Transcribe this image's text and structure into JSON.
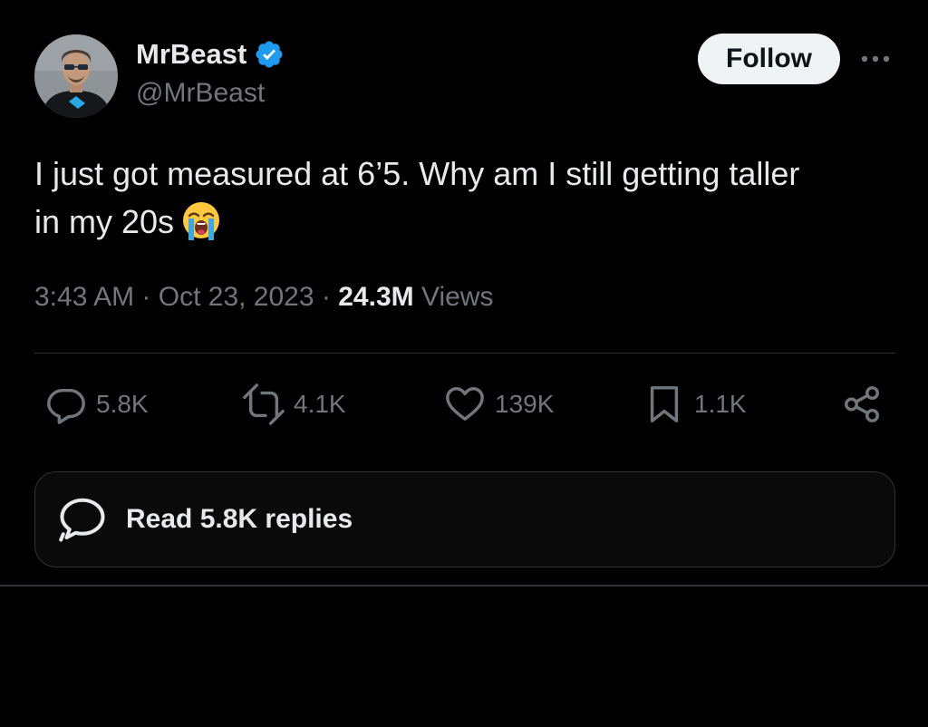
{
  "author": {
    "display_name": "MrBeast",
    "handle": "@MrBeast",
    "verified": true,
    "verified_color": "#1d9bf0",
    "avatar_icon": "profile-photo"
  },
  "header": {
    "follow_label": "Follow",
    "more_icon": "more-horizontal-icon"
  },
  "tweet": {
    "text_line1": "I just got measured at 6’5. Why am I still getting taller",
    "text_line2": "in my 20s",
    "emoji": "loudly-crying-face",
    "time": "3:43 AM",
    "date": "Oct 23, 2023",
    "separator": "·",
    "views_count": "24.3M",
    "views_label": "Views"
  },
  "actions": {
    "replies": "5.8K",
    "reposts": "4.1K",
    "likes": "139K",
    "bookmarks": "1.1K",
    "icons": [
      "reply-icon",
      "repost-icon",
      "like-icon",
      "bookmark-icon",
      "share-icon"
    ]
  },
  "replies_box": {
    "label": "Read 5.8K replies"
  },
  "colors": {
    "background": "#000000",
    "text_primary": "#e7e9ea",
    "text_secondary": "#71767b",
    "border": "#2f3336",
    "button_bg": "#eff3f4"
  }
}
